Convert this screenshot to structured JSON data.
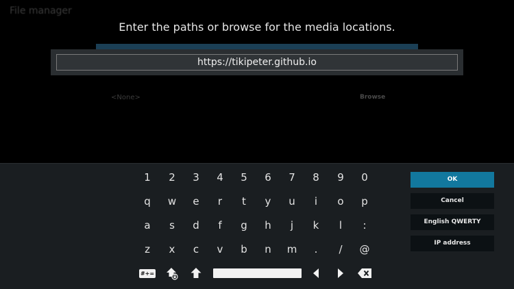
{
  "background": {
    "window_title": "File manager",
    "source_placeholder": "<None>",
    "browse_label": "Browse"
  },
  "dialog": {
    "prompt": "Enter the paths or browse for the media locations.",
    "input_value": "https://tikipeter.github.io"
  },
  "keyboard": {
    "row1": [
      "1",
      "2",
      "3",
      "4",
      "5",
      "6",
      "7",
      "8",
      "9",
      "0"
    ],
    "row2": [
      "q",
      "w",
      "e",
      "r",
      "t",
      "y",
      "u",
      "i",
      "o",
      "p"
    ],
    "row3": [
      "a",
      "s",
      "d",
      "f",
      "g",
      "h",
      "j",
      "k",
      "l",
      ":"
    ],
    "row4": [
      "z",
      "x",
      "c",
      "v",
      "b",
      "n",
      "m",
      ".",
      "/",
      "@"
    ],
    "symbols_label": "#+="
  },
  "buttons": {
    "ok": "OK",
    "cancel": "Cancel",
    "layout": "English QWERTY",
    "ip": "IP address"
  },
  "colors": {
    "accent": "#12789e",
    "keyboard_bg": "#1a1e21",
    "input_bg": "#2a2e31"
  }
}
